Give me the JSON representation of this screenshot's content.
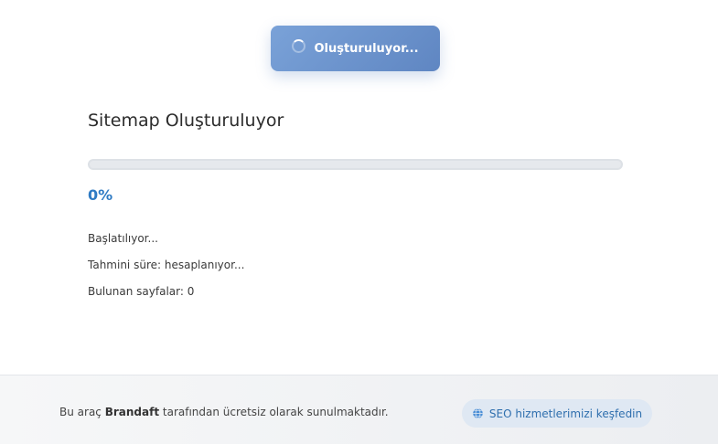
{
  "generate_button": {
    "label": "Oluşturuluyor..."
  },
  "panel": {
    "title": "Sitemap Oluşturuluyor",
    "progress": {
      "percent_text": "0%",
      "value": 0
    },
    "status": "Başlatılıyor...",
    "estimated_time": "Tahmini süre: hesaplanıyor...",
    "pages_found": "Bulunan sayfalar: 0"
  },
  "footer": {
    "text_prefix": "Bu araç",
    "brand": "Brandaft",
    "text_suffix": "tarafından ücretsiz olarak sunulmaktadır.",
    "seo_link": {
      "label": "SEO hizmetlerimizi keşfedin",
      "icon": "globe-icon"
    }
  },
  "colors": {
    "accent": "#2f7bc4",
    "button_gradient_start": "#7aa2d8",
    "button_gradient_end": "#5f86c2"
  }
}
